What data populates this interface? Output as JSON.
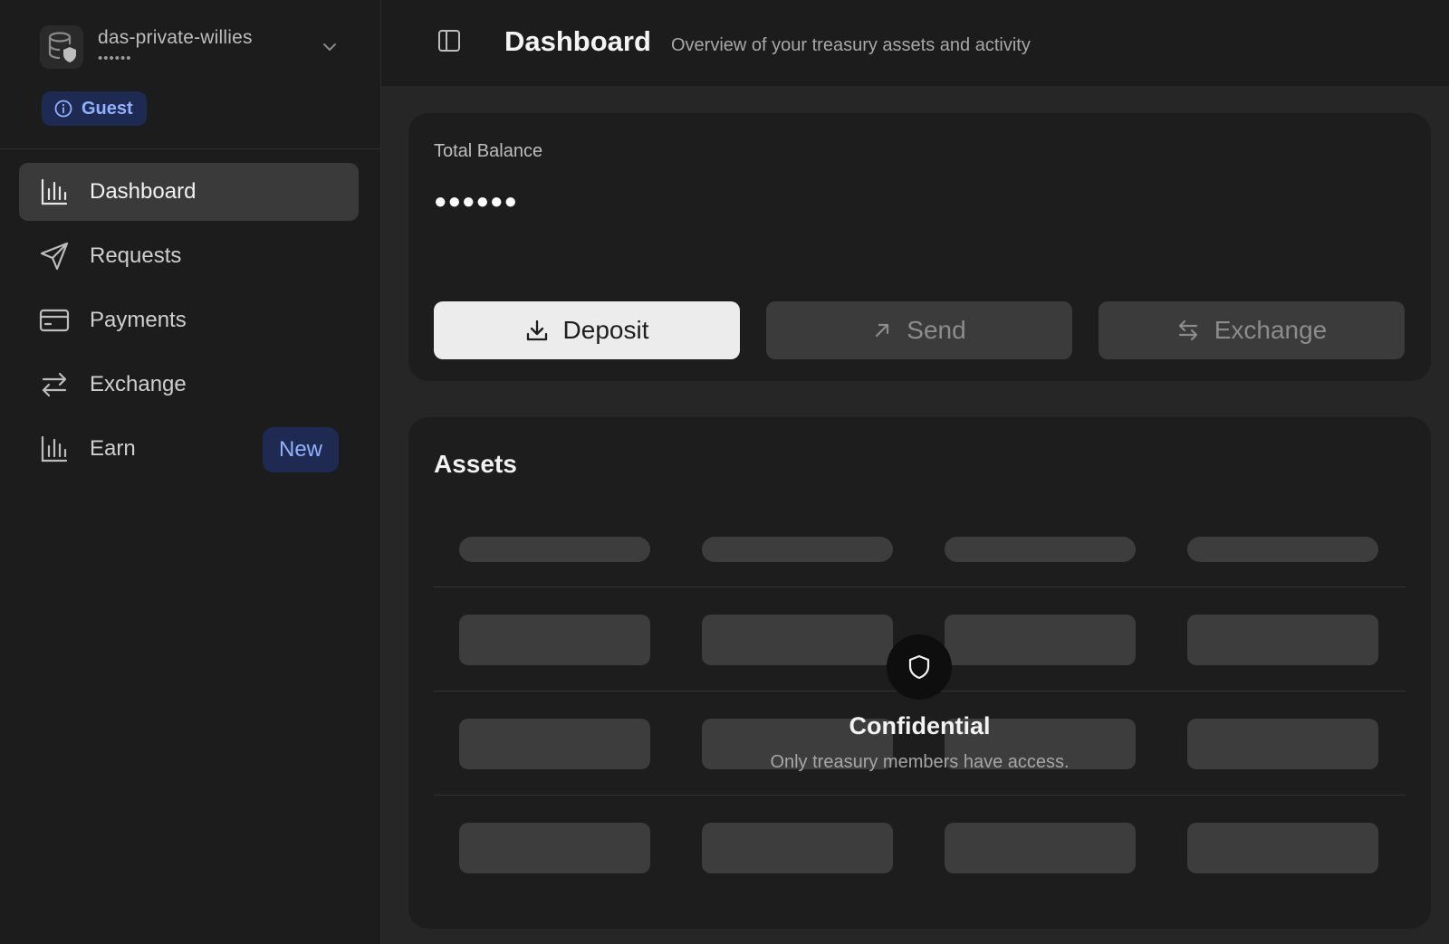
{
  "org": {
    "name": "das-private-willies",
    "subtitle": "••••••",
    "icon": "database-shield-icon"
  },
  "role_badge": {
    "label": "Guest",
    "icon": "info-icon"
  },
  "sidebar": {
    "items": [
      {
        "label": "Dashboard",
        "icon": "bar-chart-icon",
        "active": true
      },
      {
        "label": "Requests",
        "icon": "send-icon"
      },
      {
        "label": "Payments",
        "icon": "credit-card-icon"
      },
      {
        "label": "Exchange",
        "icon": "exchange-icon"
      },
      {
        "label": "Earn",
        "icon": "bar-chart-icon",
        "badge": "New"
      }
    ]
  },
  "header": {
    "title": "Dashboard",
    "subtitle": "Overview of your treasury assets and activity",
    "toggle_icon": "sidebar-toggle-icon"
  },
  "balance": {
    "label": "Total Balance",
    "value": "●●●●●●",
    "actions": [
      {
        "label": "Deposit",
        "icon": "download-icon",
        "enabled": true
      },
      {
        "label": "Send",
        "icon": "arrow-up-right-icon",
        "enabled": false
      },
      {
        "label": "Exchange",
        "icon": "swap-icon",
        "enabled": false
      }
    ]
  },
  "assets": {
    "title": "Assets",
    "overlay": {
      "icon": "shield-icon",
      "title": "Confidential",
      "subtitle": "Only treasury members have access."
    }
  },
  "colors": {
    "background": "#1c1c1c",
    "main_background": "#262626",
    "card": "#1d1d1d",
    "active_nav": "#3a3a3a",
    "badge_bg": "#1f2a52",
    "badge_text": "#8fb1ff",
    "skeleton": "#3d3d3d"
  }
}
